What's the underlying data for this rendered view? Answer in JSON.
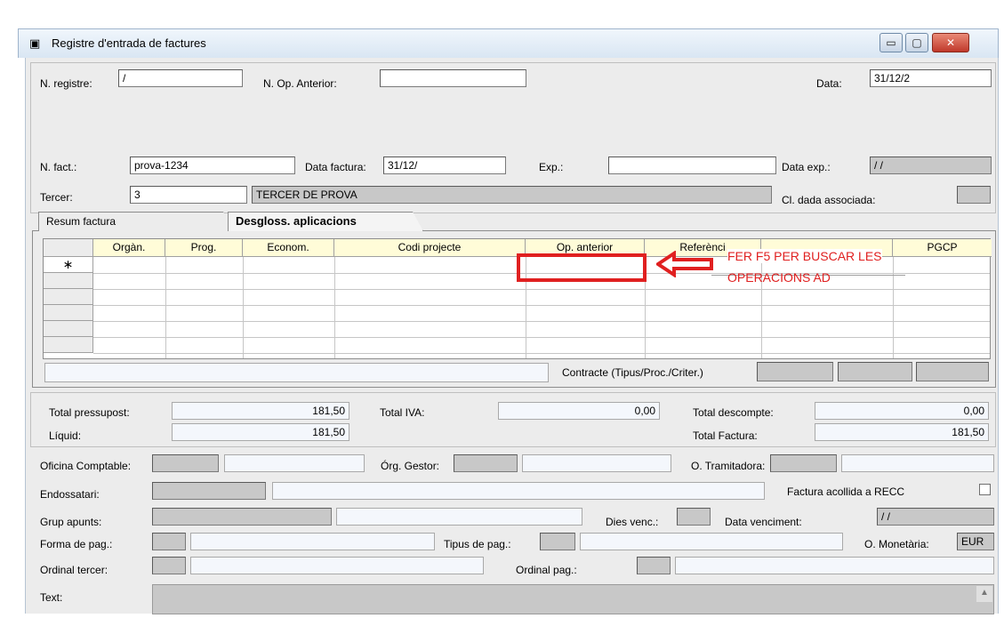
{
  "window": {
    "title": "Registre d'entrada de factures",
    "min_label": "▭",
    "max_label": "▢",
    "close_label": "✕"
  },
  "header": {
    "n_registre_label": "N. registre:",
    "n_registre_value": "/",
    "n_op_anterior_label": "N. Op. Anterior:",
    "n_op_anterior_value": "",
    "data_label": "Data:",
    "data_value": "31/12/2",
    "n_fact_label": "N. fact.:",
    "n_fact_value": "prova-1234",
    "data_factura_label": "Data factura:",
    "data_factura_value": "31/12/",
    "exp_label": "Exp.:",
    "exp_value": "",
    "data_exp_label": "Data exp.:",
    "data_exp_value": "/ /",
    "tercer_label": "Tercer:",
    "tercer_code": "3",
    "tercer_name": "TERCER DE PROVA",
    "cl_dada_label": "Cl. dada associada:"
  },
  "tabs": [
    {
      "label": "Resum factura",
      "active": false
    },
    {
      "label": "Desgloss. aplicacions",
      "active": true
    }
  ],
  "grid": {
    "columns": [
      "Orgàn.",
      "Prog.",
      "Econom.",
      "Codi projecte",
      "Op. anterior",
      "Referènci",
      "",
      "PGCP"
    ],
    "new_row_marker": "∗"
  },
  "annotation": {
    "text_line1": "FER F5 PER BUSCAR LES",
    "text_line2": "OPERACIONS AD",
    "color": "#e02020"
  },
  "contracte_label": "Contracte (Tipus/Proc./Criter.)",
  "totals": {
    "total_pressupost_label": "Total pressupost:",
    "total_pressupost_value": "181,50",
    "liquid_label": "Líquid:",
    "liquid_value": "181,50",
    "total_iva_label": "Total IVA:",
    "total_iva_value": "0,00",
    "total_descompte_label": "Total descompte:",
    "total_descompte_value": "0,00",
    "total_factura_label": "Total Factura:",
    "total_factura_value": "181,50"
  },
  "bottom": {
    "oficina_comptable_label": "Oficina Comptable:",
    "org_gestor_label": "Órg. Gestor:",
    "o_tramitadora_label": "O. Tramitadora:",
    "endossatari_label": "Endossatari:",
    "factura_recc_label": "Factura acollida a RECC",
    "grup_apunts_label": "Grup apunts:",
    "dies_venc_label": "Dies venc.:",
    "data_venciment_label": "Data venciment:",
    "data_venciment_value": "/ /",
    "forma_pag_label": "Forma de pag.:",
    "tipus_pag_label": "Tipus de pag.:",
    "o_monetaria_label": "O. Monetària:",
    "o_monetaria_value": "EUR",
    "ordinal_tercer_label": "Ordinal tercer:",
    "ordinal_pag_label": "Ordinal pag.:",
    "text_label": "Text:"
  }
}
